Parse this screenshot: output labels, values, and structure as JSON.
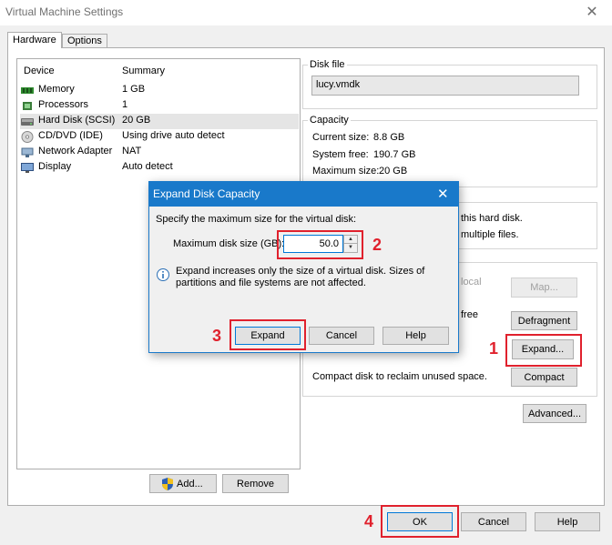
{
  "window": {
    "title": "Virtual Machine Settings",
    "close_glyph": "✕"
  },
  "tabs": [
    {
      "label": "Hardware",
      "active": true
    },
    {
      "label": "Options",
      "active": false
    }
  ],
  "device_list": {
    "col_device": "Device",
    "col_summary": "Summary",
    "rows": [
      {
        "device": "Memory",
        "summary": "1 GB",
        "icon": "memory-icon",
        "selected": false
      },
      {
        "device": "Processors",
        "summary": "1",
        "icon": "processor-icon",
        "selected": false
      },
      {
        "device": "Hard Disk (SCSI)",
        "summary": "20 GB",
        "icon": "hard-disk-icon",
        "selected": true
      },
      {
        "device": "CD/DVD (IDE)",
        "summary": "Using drive auto detect",
        "icon": "cd-dvd-icon",
        "selected": false
      },
      {
        "device": "Network Adapter",
        "summary": "NAT",
        "icon": "network-adapter-icon",
        "selected": false
      },
      {
        "device": "Display",
        "summary": "Auto detect",
        "icon": "display-icon",
        "selected": false
      }
    ]
  },
  "left_buttons": {
    "add": "Add...",
    "remove": "Remove"
  },
  "disk_file": {
    "title": "Disk file",
    "value": "lucy.vmdk"
  },
  "capacity": {
    "title": "Capacity",
    "current_label": "Current size:",
    "current_value": "8.8 GB",
    "free_label": "System free:",
    "free_value": "190.7 GB",
    "max_label": "Maximum size:",
    "max_value": "20 GB"
  },
  "info_fragments": {
    "line1": "this hard disk.",
    "line2": "multiple files.",
    "local": "local",
    "free": "free"
  },
  "utilities": {
    "map": "Map...",
    "defragment": "Defragment",
    "expand": "Expand...",
    "compact_text": "Compact disk to reclaim unused space.",
    "compact": "Compact",
    "advanced": "Advanced..."
  },
  "bottom_buttons": {
    "ok": "OK",
    "cancel": "Cancel",
    "help": "Help"
  },
  "dialog": {
    "title": "Expand Disk Capacity",
    "instruction": "Specify the maximum size for the virtual disk:",
    "size_label": "Maximum disk size (GB):",
    "size_value": "50.0",
    "info_text_line1": "Expand increases only the size of a virtual disk. Sizes of",
    "info_text_line2": "partitions and file systems are not affected.",
    "expand": "Expand",
    "cancel": "Cancel",
    "help": "Help"
  },
  "annotations": {
    "n1": "1",
    "n2": "2",
    "n3": "3",
    "n4": "4",
    "color": "#e0212d"
  },
  "colors": {
    "accent": "#1979ca",
    "highlight": "#e0212d",
    "selected_row": "#e5e5e5"
  }
}
